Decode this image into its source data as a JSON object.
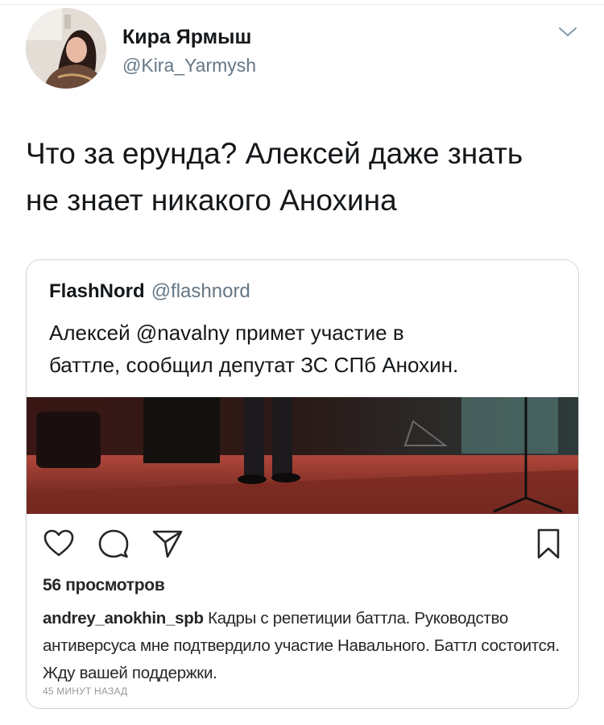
{
  "tweet": {
    "author_name": "Кира Ярмыш",
    "author_handle": "@Kira_Yarmysh",
    "text": "Что за ерунда? Алексей даже знать\nне знает никакого Анохина",
    "menu_icon": "chevron-down-icon"
  },
  "quote": {
    "author_name": "FlashNord",
    "author_handle": "@flashnord",
    "text": "Алексей @navalny примет участие в\nбаттле, сообщил депутат ЗС СПб Анохин."
  },
  "instagram": {
    "icons": [
      "heart-icon",
      "comment-icon",
      "share-icon",
      "bookmark-icon"
    ],
    "views": "56 просмотров",
    "caption_user": "andrey_anokhin_spb",
    "caption_text": " Кадры с репетиции баттла. Руководство антиверсуса мне подтвердило участие Навального. Баттл состоится. Жду вашей поддержки.",
    "time": "45 МИНУТ НАЗАД"
  },
  "colors": {
    "text": "#14171a",
    "secondary": "#657786",
    "border": "#ccd6dd",
    "ig_text": "#262626",
    "ig_time": "#999999"
  }
}
